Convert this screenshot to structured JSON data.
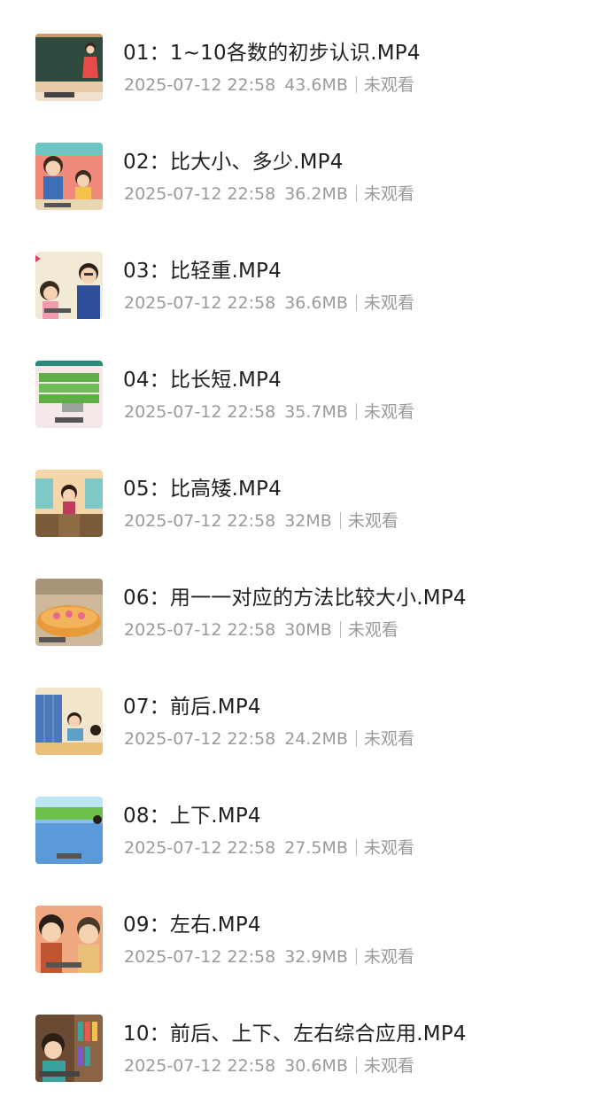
{
  "files": [
    {
      "name": "01：1~10各数的初步认识.MP4",
      "date": "2025-07-12 22:58",
      "size": "43.6MB",
      "status": "未观看",
      "thumb_icon": "teacher-at-blackboard-thumbnail",
      "thumb_colors": {
        "bg": "#2f4a3e",
        "accent": "#e84a4a"
      }
    },
    {
      "name": "02：比大小、多少.MP4",
      "date": "2025-07-12 22:58",
      "size": "36.2MB",
      "status": "未观看",
      "thumb_icon": "two-kids-cartoon-thumbnail",
      "thumb_colors": {
        "bg": "#f08a7a",
        "accent": "#3d6fb6"
      }
    },
    {
      "name": "03：比轻重.MP4",
      "date": "2025-07-12 22:58",
      "size": "36.6MB",
      "status": "未观看",
      "thumb_icon": "kid-and-teacher-thumbnail",
      "thumb_colors": {
        "bg": "#f3ead6",
        "accent": "#2f4f9a"
      }
    },
    {
      "name": "04：比长短.MP4",
      "date": "2025-07-12 22:58",
      "size": "35.7MB",
      "status": "未观看",
      "thumb_icon": "green-blocks-thumbnail",
      "thumb_colors": {
        "bg": "#f6e8e8",
        "accent": "#5fae4a"
      }
    },
    {
      "name": "05：比高矮.MP4",
      "date": "2025-07-12 22:58",
      "size": "32MB",
      "status": "未观看",
      "thumb_icon": "podium-kid-thumbnail",
      "thumb_colors": {
        "bg": "#f5d6a8",
        "accent": "#7b5a3a"
      }
    },
    {
      "name": "06：用一一对应的方法比较大小.MP4",
      "date": "2025-07-12 22:58",
      "size": "30MB",
      "status": "未观看",
      "thumb_icon": "dining-table-thumbnail",
      "thumb_colors": {
        "bg": "#cdb89a",
        "accent": "#e89a3a"
      }
    },
    {
      "name": "07：前后.MP4",
      "date": "2025-07-12 22:58",
      "size": "24.2MB",
      "status": "未观看",
      "thumb_icon": "classroom-lockers-thumbnail",
      "thumb_colors": {
        "bg": "#4b78b8",
        "accent": "#e8c07a"
      }
    },
    {
      "name": "08：上下.MP4",
      "date": "2025-07-12 22:58",
      "size": "27.5MB",
      "status": "未观看",
      "thumb_icon": "pool-outdoor-thumbnail",
      "thumb_colors": {
        "bg": "#5a9ad8",
        "accent": "#6bbf4a"
      }
    },
    {
      "name": "09：左右.MP4",
      "date": "2025-07-12 22:58",
      "size": "32.9MB",
      "status": "未观看",
      "thumb_icon": "two-faces-thumbnail",
      "thumb_colors": {
        "bg": "#f0a880",
        "accent": "#c0552f"
      }
    },
    {
      "name": "10：前后、上下、左右综合应用.MP4",
      "date": "2025-07-12 22:58",
      "size": "30.6MB",
      "status": "未观看",
      "thumb_icon": "kid-bookshelf-thumbnail",
      "thumb_colors": {
        "bg": "#6a4a32",
        "accent": "#3aa3a0"
      }
    }
  ]
}
